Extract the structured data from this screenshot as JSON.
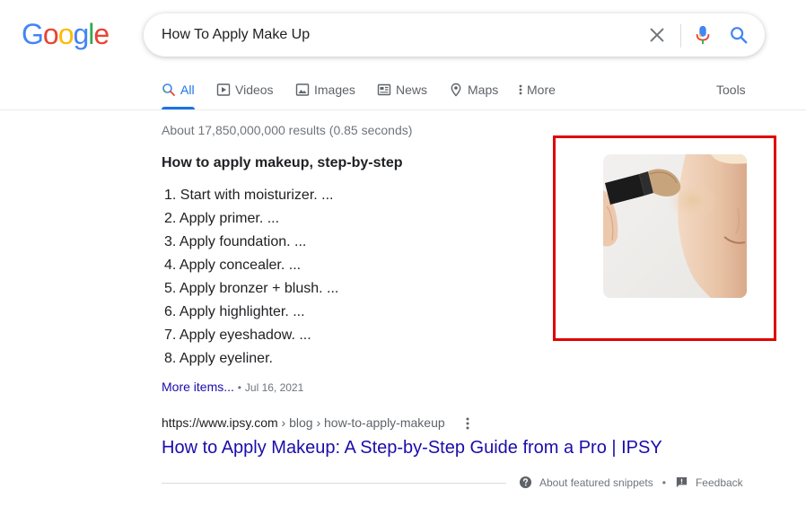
{
  "logo": {
    "letters": [
      "G",
      "o",
      "o",
      "g",
      "l",
      "e"
    ],
    "colors": [
      "#4285f4",
      "#ea4335",
      "#fbbc05",
      "#4285f4",
      "#34a853",
      "#ea4335"
    ]
  },
  "search": {
    "query": "How To Apply Make Up"
  },
  "tabs": [
    {
      "label": "All",
      "icon": "search-icon",
      "active": true
    },
    {
      "label": "Videos",
      "icon": "video-icon"
    },
    {
      "label": "Images",
      "icon": "image-icon"
    },
    {
      "label": "News",
      "icon": "news-icon"
    },
    {
      "label": "Maps",
      "icon": "map-pin-icon"
    },
    {
      "label": "More",
      "icon": "kebab-icon"
    }
  ],
  "tools_label": "Tools",
  "result_stats": "About 17,850,000,000 results (0.85 seconds)",
  "snippet": {
    "heading": "How to apply makeup, step-by-step",
    "steps": [
      "1. Start with moisturizer. ...",
      "2. Apply primer. ...",
      "3. Apply foundation. ...",
      "4. Apply concealer. ...",
      "5. Apply bronzer + blush. ...",
      "6. Apply highlighter. ...",
      "7. Apply eyeshadow. ...",
      "8. Apply eyeliner."
    ],
    "more_items": "More items...",
    "separator": "•",
    "date": "Jul 16, 2021"
  },
  "result": {
    "domain": "https://www.ipsy.com",
    "path": " › blog › how-to-apply-makeup",
    "title": "How to Apply Makeup: A Step-by-Step Guide from a Pro | IPSY"
  },
  "footer": {
    "about": "About featured snippets",
    "separator": "•",
    "feedback": "Feedback"
  },
  "colors": {
    "accent": "#1a73e8",
    "link": "#1a0dab",
    "highlight": "#e00000"
  }
}
